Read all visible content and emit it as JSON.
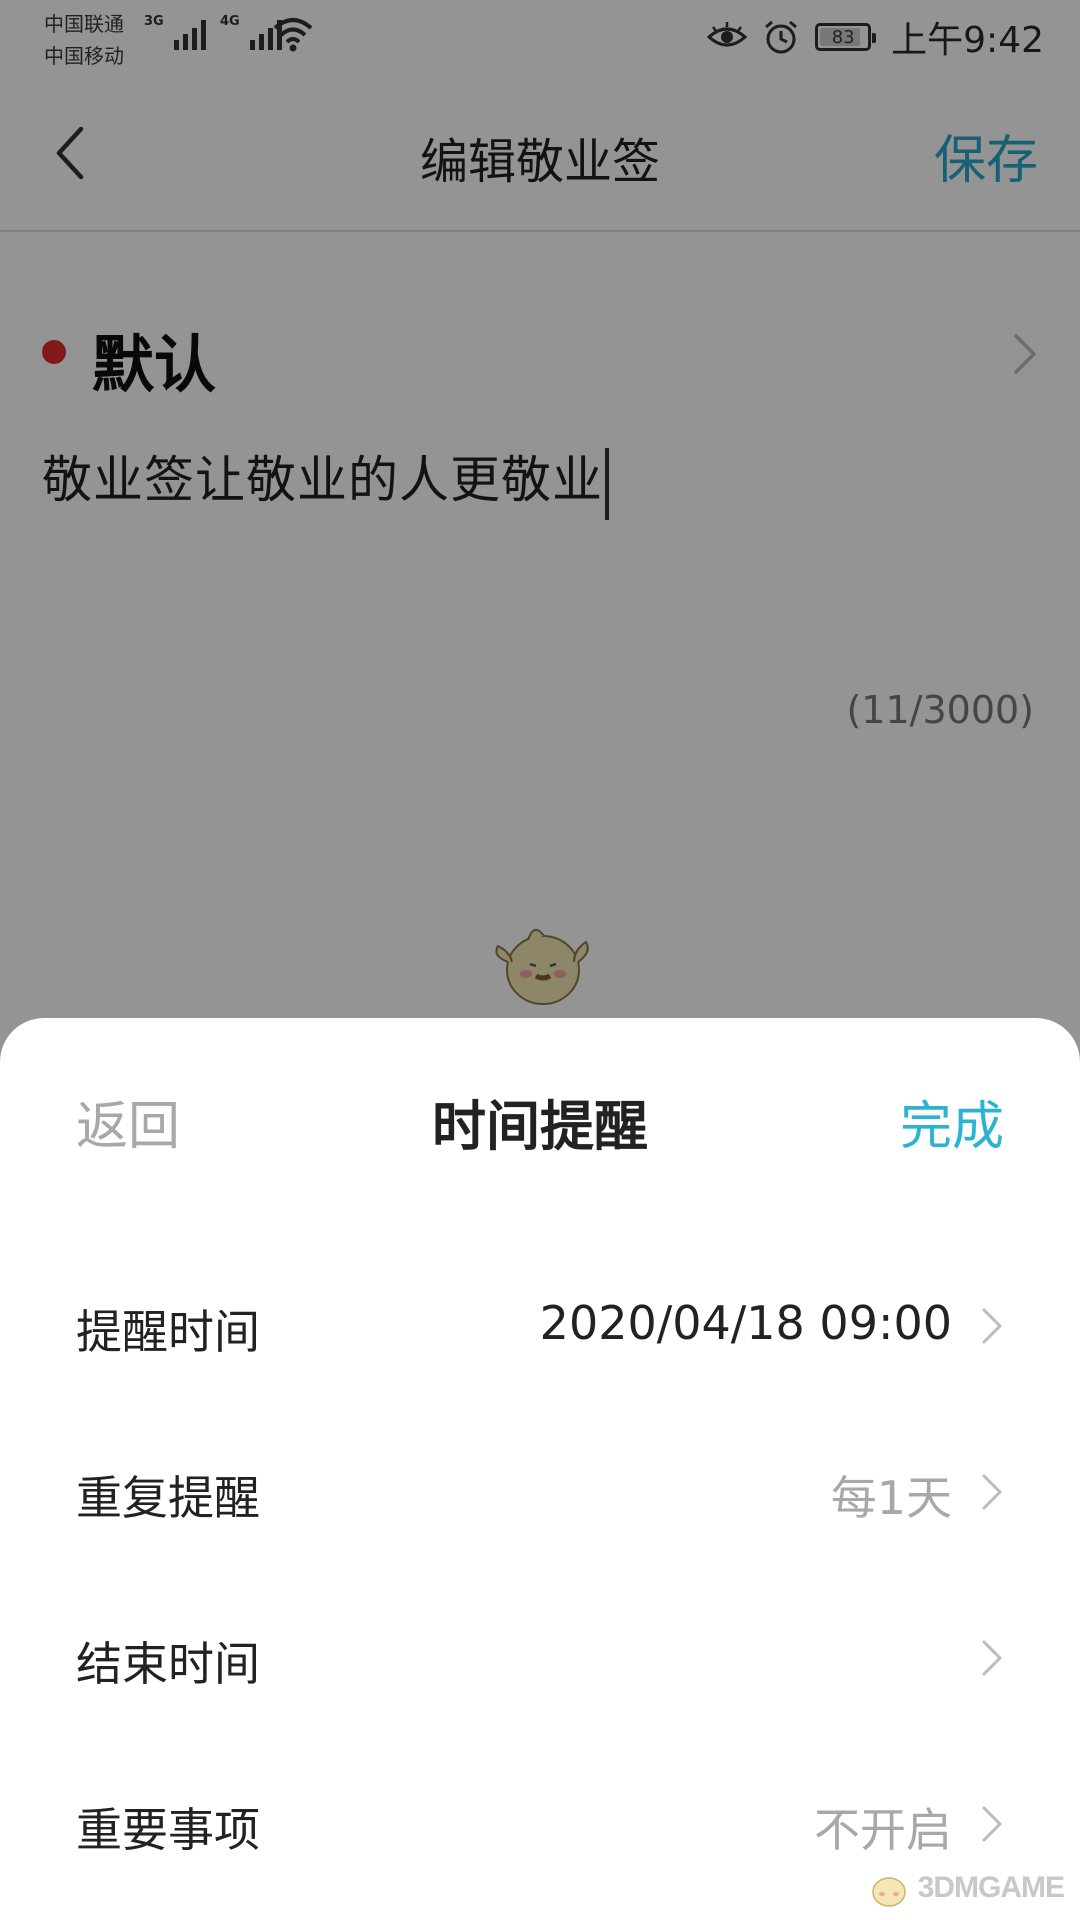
{
  "status_bar": {
    "carrier_1": "中国联通",
    "carrier_2": "中国移动",
    "network_1": "3G",
    "network_2": "4G",
    "battery_level": "83",
    "time": "上午9:42",
    "icons": [
      "signal-icon",
      "wifi-icon",
      "eye-icon",
      "alarm-icon",
      "battery-icon"
    ]
  },
  "nav": {
    "back_icon": "chevron-left-icon",
    "title": "编辑敬业签",
    "save_label": "保存"
  },
  "note": {
    "category": "默认",
    "category_color": "#e02b2b",
    "text": "敬业签让敬业的人更敬业",
    "char_count": "(11/3000)"
  },
  "sheet": {
    "back_label": "返回",
    "title": "时间提醒",
    "done_label": "完成",
    "rows": [
      {
        "label": "提醒时间",
        "value": "2020/04/18 09:00"
      },
      {
        "label": "重复提醒",
        "value": "每1天"
      },
      {
        "label": "结束时间",
        "value": ""
      },
      {
        "label": "重要事项",
        "value": "不开启"
      }
    ]
  },
  "watermark": {
    "text": "3DMGAME"
  },
  "colors": {
    "accent": "#2aa6c9",
    "done": "#2bb3d1",
    "muted": "#a8a8a8",
    "overlay": "rgba(0,0,0,0.42)"
  }
}
